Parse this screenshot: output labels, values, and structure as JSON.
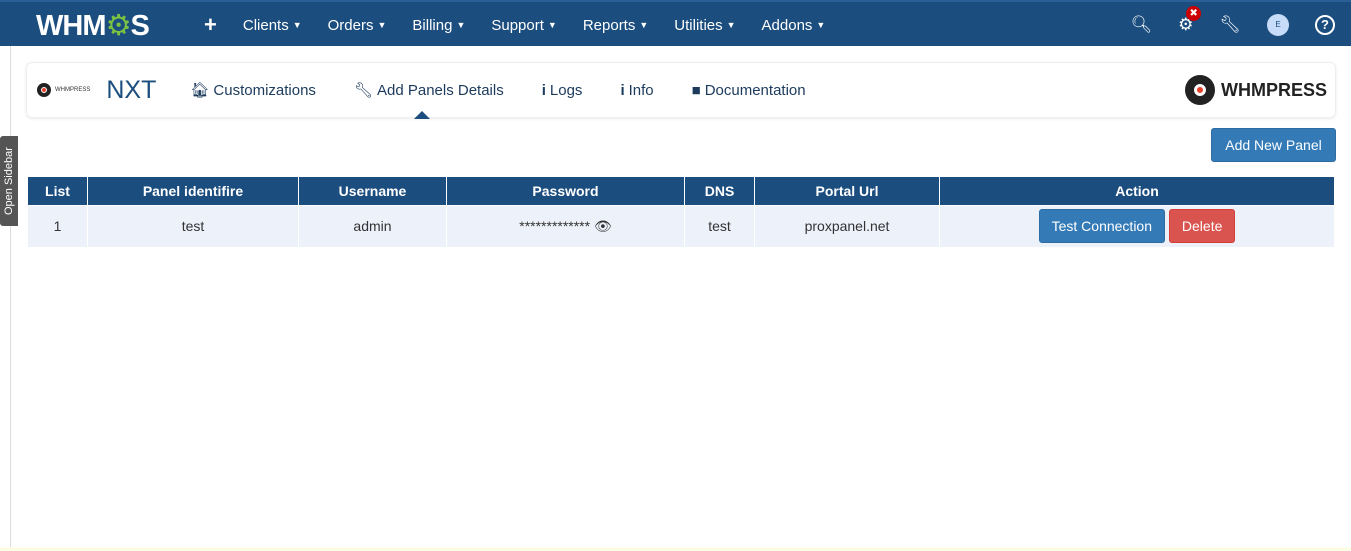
{
  "topbar": {
    "logo": "WHMCS",
    "nav": [
      "Clients",
      "Orders",
      "Billing",
      "Support",
      "Reports",
      "Utilities",
      "Addons"
    ],
    "avatar_initial": "E",
    "badge_symbol": "✖"
  },
  "sidebar_tab": "Open Sidebar",
  "module": {
    "mini_logo": "WHMPRESS",
    "title": "NXT",
    "tabs": [
      "Customizations",
      "Add Panels Details",
      "Logs",
      "Info",
      "Documentation"
    ],
    "brand": "WHMPRESS"
  },
  "add_button": "Add New Panel",
  "table": {
    "headers": [
      "List",
      "Panel identifire",
      "Username",
      "Password",
      "DNS",
      "Portal Url",
      "Action"
    ],
    "rows": [
      {
        "list": "1",
        "identifier": "test",
        "username": "admin",
        "password": "*************",
        "dns": "test",
        "portal": "proxpanel.net",
        "test_label": "Test Connection",
        "delete_label": "Delete"
      }
    ]
  }
}
